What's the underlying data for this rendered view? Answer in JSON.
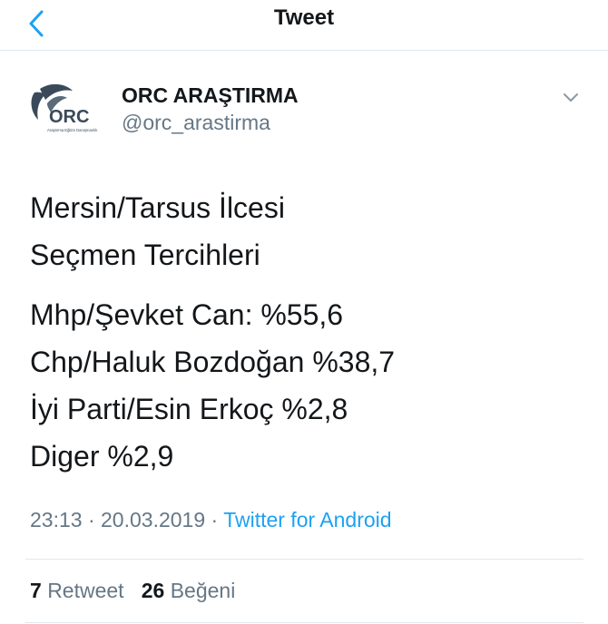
{
  "header": {
    "title": "Tweet",
    "back_icon": "chevron-left-icon",
    "accent_color": "#1da1f2"
  },
  "author": {
    "name": "ORC ARAŞTIRMA",
    "handle": "@orc_arastirma",
    "logo_text": "ORC",
    "logo_tagline": "Araştırma Eğitim Danışmanlık",
    "more_icon": "chevron-down-icon"
  },
  "tweet": {
    "paragraphs": [
      [
        "Mersin/Tarsus İlcesi",
        "Seçmen Tercihleri"
      ],
      [
        "Mhp/Şevket Can: %55,6",
        "Chp/Haluk Bozdoğan %38,7",
        "İyi Parti/Esin Erkoç %2,8",
        "Diger %2,9"
      ]
    ]
  },
  "meta": {
    "time": "23:13",
    "date": "20.03.2019",
    "separator": "·",
    "source": "Twitter for Android"
  },
  "stats": {
    "retweets_count": "7",
    "retweets_label": "Retweet",
    "likes_count": "26",
    "likes_label": "Beğeni"
  }
}
